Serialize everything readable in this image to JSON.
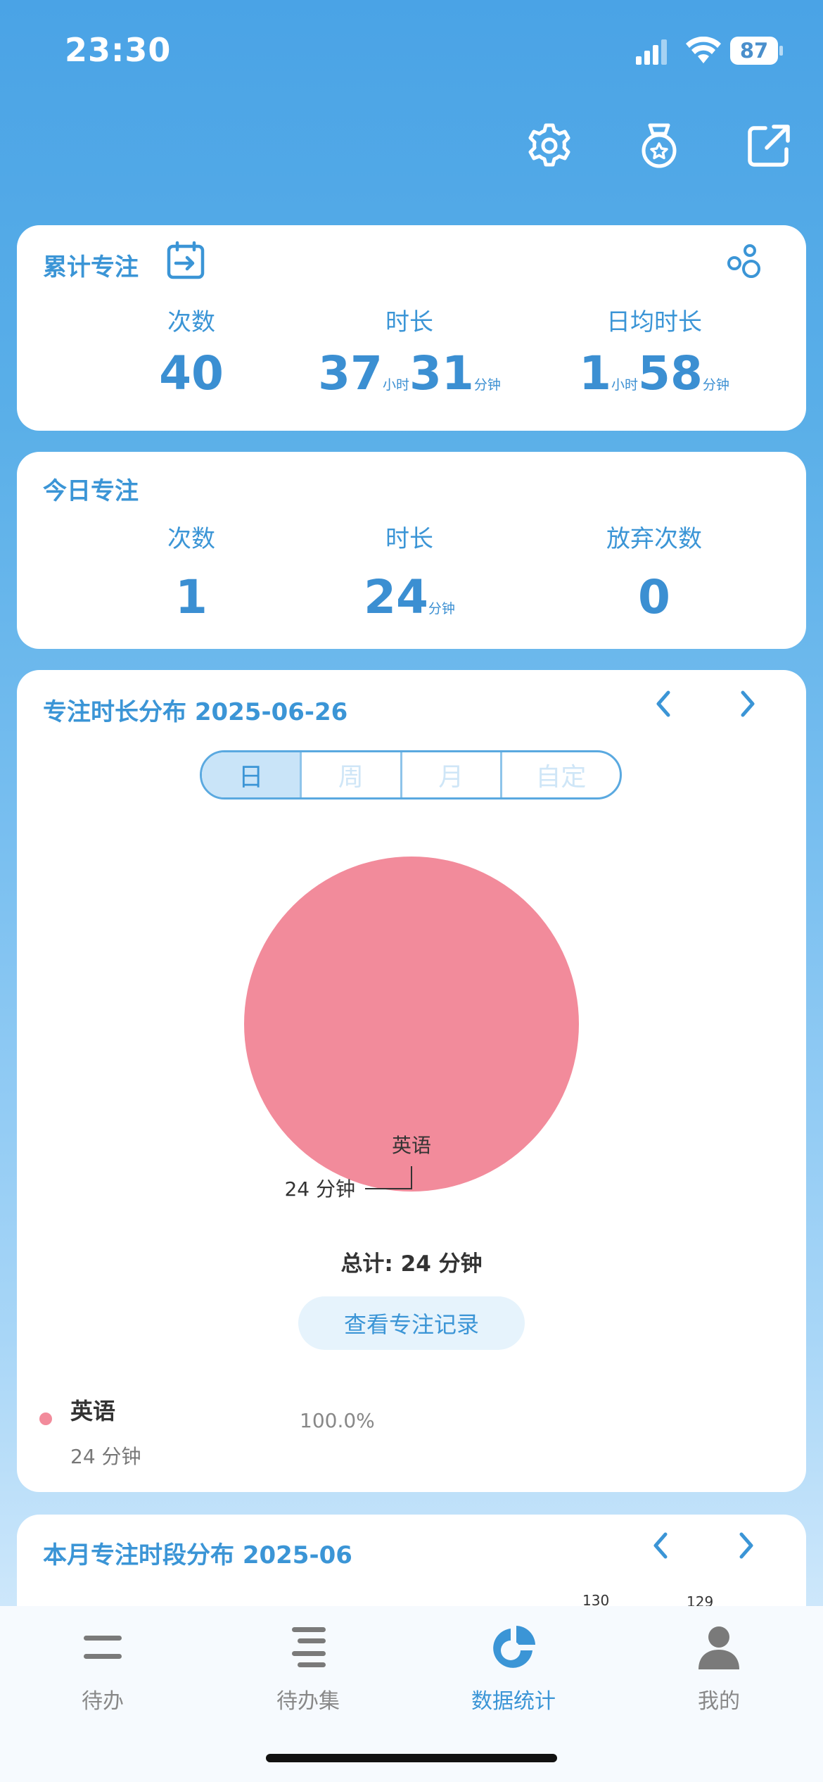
{
  "status_bar": {
    "time": "23:30",
    "battery": "87"
  },
  "top_actions": [
    "settings-icon",
    "medal-icon",
    "share-icon"
  ],
  "cumulative": {
    "title": "累计专注",
    "count_label": "次数",
    "count_value": "40",
    "duration_label": "时长",
    "duration_hours": "37",
    "duration_hours_unit": "小时",
    "duration_minutes": "31",
    "duration_minutes_unit": "分钟",
    "daily_label": "日均时长",
    "daily_hours": "1",
    "daily_hours_unit": "小时",
    "daily_minutes": "58",
    "daily_minutes_unit": "分钟"
  },
  "today": {
    "title": "今日专注",
    "count_label": "次数",
    "count_value": "1",
    "duration_label": "时长",
    "duration_value": "24",
    "duration_unit": "分钟",
    "abandon_label": "放弃次数",
    "abandon_value": "0"
  },
  "distribution": {
    "title": "专注时长分布 2025-06-26",
    "segments": [
      "日",
      "周",
      "月",
      "自定"
    ],
    "active_segment": "日",
    "total": "总计: 24 分钟",
    "record_button": "查看专注记录",
    "legend": [
      {
        "name": "英语",
        "duration": "24 分钟",
        "percent": "100.0%",
        "color": "#f28b9b"
      }
    ]
  },
  "chart_data": {
    "type": "pie",
    "slices": [
      {
        "label": "英语",
        "value": 24,
        "display": "24 分钟",
        "color": "#f28b9b"
      }
    ]
  },
  "monthly": {
    "title": "本月专注时段分布  2025-06",
    "peek_labels": [
      "130",
      "129"
    ]
  },
  "tabs": [
    {
      "label": "待办",
      "icon": "todo-icon"
    },
    {
      "label": "待办集",
      "icon": "todo-set-icon"
    },
    {
      "label": "数据统计",
      "icon": "stats-pie-icon"
    },
    {
      "label": "我的",
      "icon": "profile-icon"
    }
  ],
  "active_tab": "数据统计",
  "colors": {
    "accent": "#3b95d6",
    "pie": "#f28b9b"
  }
}
